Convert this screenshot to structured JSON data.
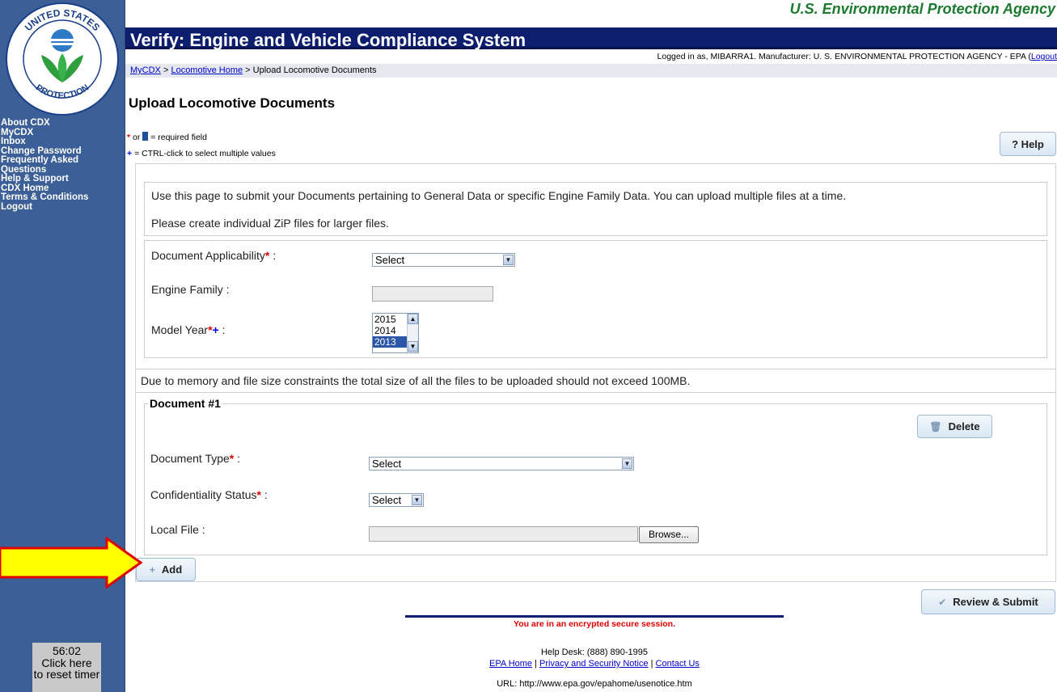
{
  "agency": "U.S. Environmental Protection Agency",
  "app_title": "Verify: Engine and Vehicle Compliance System",
  "logged_in": {
    "text": "Logged in as, MIBARRA1. Manufacturer: U. S. ENVIRONMENTAL PROTECTION AGENCY - EPA (",
    "logout_label": "Logout"
  },
  "breadcrumb": {
    "item1": "MyCDX",
    "sep": ">",
    "item2": "Locomotive Home",
    "item3": "Upload Locomotive Documents"
  },
  "sidebar": {
    "seal": {
      "top_text": "UNITED STATES",
      "left_text": "ENVIRONMENTAL",
      "right_text": "AGENCY",
      "bottom_text": "PROTECTION"
    },
    "items": [
      "About CDX",
      "MyCDX",
      "Inbox",
      "Change Password",
      "Frequently Asked",
      "Questions",
      "Help & Support",
      "CDX Home",
      "Terms & Conditions",
      "Logout"
    ],
    "timer": {
      "time": "56:02",
      "line1": "Click here",
      "line2": "to reset timer"
    }
  },
  "page_title": "Upload Locomotive Documents",
  "legend": {
    "or": "or",
    "required": "= required field",
    "multi": "= CTRL-click to select multiple values"
  },
  "help_button": "? Help",
  "intro": {
    "line1": "Use this page to submit your Documents pertaining to General Data or specific Engine Family Data. You can upload multiple files at a time.",
    "line2": "Please create individual ZiP files for larger files."
  },
  "form": {
    "applicability_label": "Document Applicability",
    "applicability_value": "Select",
    "engine_family_label": "Engine Family :",
    "engine_family_value": "",
    "model_year_label": "Model Year",
    "model_years": [
      "2015",
      "2014",
      "2013"
    ],
    "model_year_selected": "2013"
  },
  "size_note": "Due to memory and file size constraints the total size of all the files to be uploaded should not exceed 100MB.",
  "document": {
    "legend": "Document #1",
    "delete_label": "Delete",
    "type_label": "Document Type",
    "type_value": "Select",
    "confidentiality_label": "Confidentiality Status",
    "confidentiality_value": "Select",
    "local_file_label": "Local File :",
    "local_file_value": "",
    "browse_label": "Browse..."
  },
  "add_label": "Add",
  "review_label": "Review & Submit",
  "footer": {
    "secure": "You are in an encrypted secure session.",
    "helpdesk": "Help Desk: (888) 890-1995",
    "link1": "EPA Home",
    "link2": "Privacy and Security Notice",
    "link3": "Contact Us",
    "url": "URL: http://www.epa.gov/epahome/usenotice.htm"
  },
  "colors": {
    "sidebar_bg": "#3b5f96",
    "title_bar": "#0e1e6f",
    "agency_green": "#1b7a2f",
    "required_red": "#e00000",
    "arrow_yellow": "#ffff00"
  }
}
